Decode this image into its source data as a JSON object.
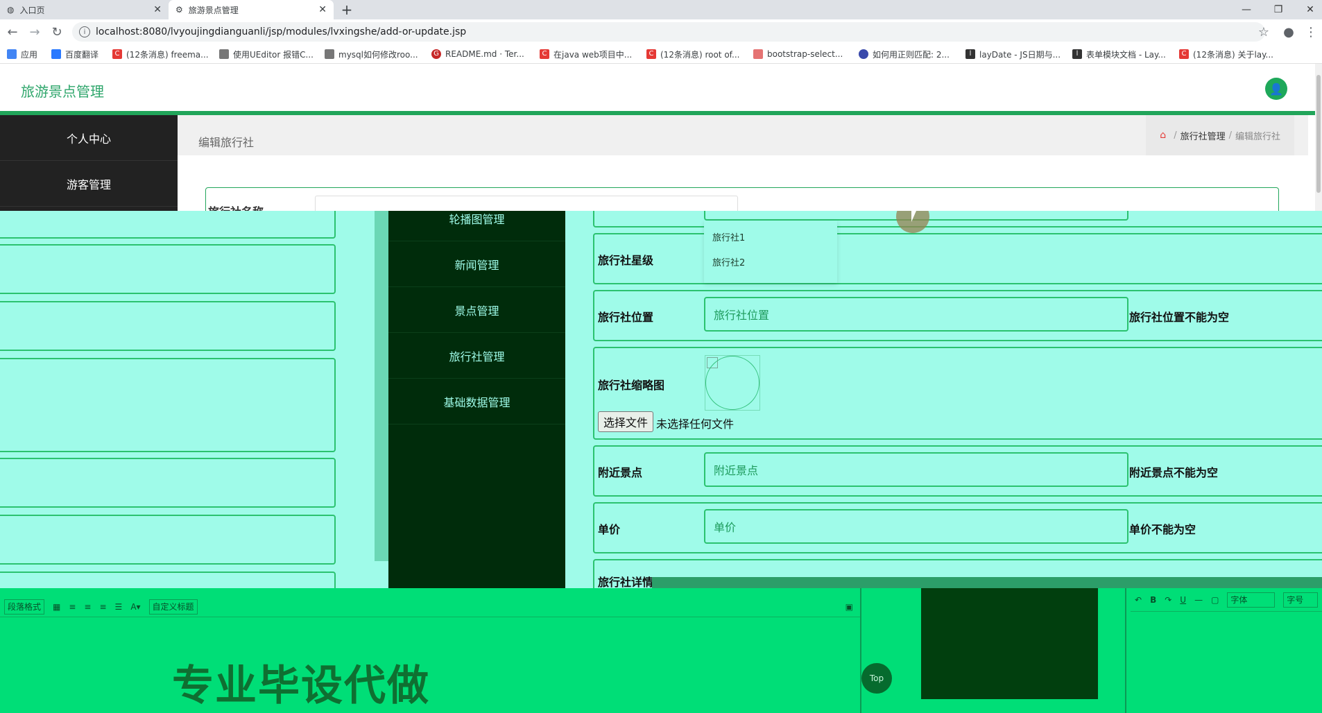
{
  "browser": {
    "tabs": [
      {
        "title": "入口页",
        "icon": "globe-icon"
      },
      {
        "title": "旅游景点管理",
        "icon": "settings-icon"
      }
    ],
    "url": "localhost:8080/lvyoujingdianguanli/jsp/modules/lvxingshe/add-or-update.jsp",
    "bookmarks": [
      {
        "label": "应用",
        "color": "#4285f4"
      },
      {
        "label": "百度翻译",
        "color": "#2979ff"
      },
      {
        "label": "(12条消息) freema...",
        "color": "#e53935"
      },
      {
        "label": "使用UEditor 报错C...",
        "color": "#555555"
      },
      {
        "label": "mysql如何修改roo...",
        "color": "#555555"
      },
      {
        "label": "README.md · Ter...",
        "color": "#c62828"
      },
      {
        "label": "在java web项目中...",
        "color": "#e53935"
      },
      {
        "label": "(12条消息) root of...",
        "color": "#e53935"
      },
      {
        "label": "bootstrap-select...",
        "color": "#e57373"
      },
      {
        "label": "如何用正则匹配: 2...",
        "color": "#3949ab"
      },
      {
        "label": "layDate - JS日期与...",
        "color": "#333333"
      },
      {
        "label": "表单模块文档 - Lay...",
        "color": "#333333"
      },
      {
        "label": "(12条消息) 关于lay...",
        "color": "#e53935"
      }
    ]
  },
  "app": {
    "title": "旅游景点管理",
    "edit_title": "编辑旅行社",
    "breadcrumb": {
      "parent": "旅行社管理",
      "current": "编辑旅行社",
      "sep": "/"
    },
    "sidebar_top": [
      "个人中心",
      "游客管理"
    ],
    "sidebar_menu": [
      "轮播图管理",
      "新闻管理",
      "景点管理",
      "旅行社管理",
      "基础数据管理"
    ],
    "top_field_label": "旅行社名称"
  },
  "form": {
    "star_label": "旅行社星级",
    "star_options": [
      "旅行社1",
      "旅行社2"
    ],
    "location_label": "旅行社位置",
    "location_placeholder": "旅行社位置",
    "location_error": "旅行社位置不能为空",
    "thumb_label": "旅行社缩略图",
    "file_button": "选择文件",
    "file_status": "未选择任何文件",
    "nearby_label": "附近景点",
    "nearby_placeholder": "附近景点",
    "nearby_error": "附近景点不能为空",
    "price_label": "单价",
    "price_placeholder": "单价",
    "price_error": "单价不能为空",
    "detail_label": "旅行社详情"
  },
  "editor": {
    "paragraph_format": "段落格式",
    "custom_title": "自定义标题",
    "font": "字体",
    "font_size": "字号",
    "watermark": "专业毕设代做",
    "top_button": "Top"
  },
  "colors": {
    "brand": "#21a55a",
    "overlay": "#9ffbe9",
    "menu_dark": "#002c0b",
    "editor_green": "#00de77"
  }
}
